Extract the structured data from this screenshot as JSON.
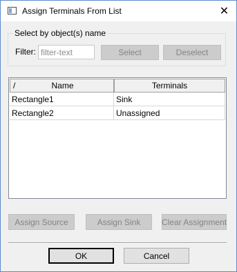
{
  "window": {
    "title": "Assign Terminals From List",
    "icon": "app-window-icon",
    "close_glyph": "✕"
  },
  "select_group": {
    "legend": "Select by object(s) name",
    "filter_label": "Filter:",
    "filter_placeholder": "filter-text",
    "select_label": "Select",
    "deselect_label": "Deselect"
  },
  "table": {
    "sort_glyph": "/",
    "columns": [
      "Name",
      "Terminals"
    ],
    "rows": [
      {
        "name": "Rectangle1",
        "terminal": "Sink"
      },
      {
        "name": "Rectangle2",
        "terminal": "Unassigned"
      }
    ]
  },
  "assign": {
    "source_label": "Assign Source",
    "sink_label": "Assign Sink",
    "clear_label": "Clear Assignment"
  },
  "footer": {
    "ok_label": "OK",
    "cancel_label": "Cancel"
  }
}
